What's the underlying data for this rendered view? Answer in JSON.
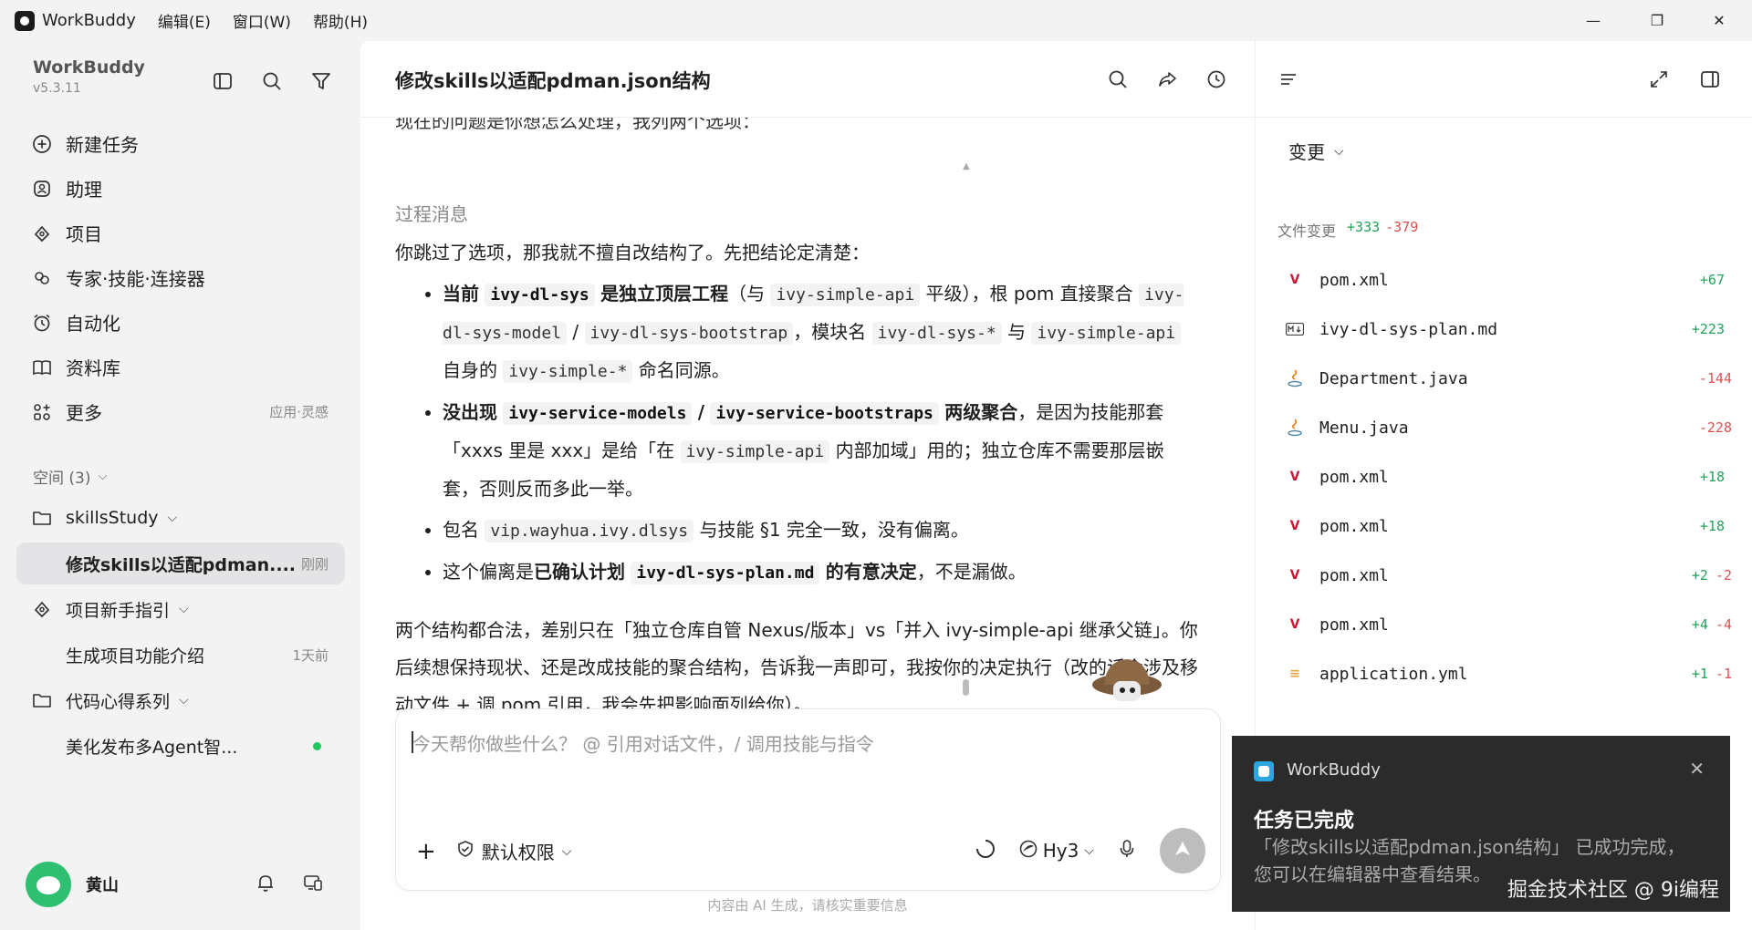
{
  "titlebar": {
    "app_name": "WorkBuddy",
    "menus": [
      "编辑(E)",
      "窗口(W)",
      "帮助(H)"
    ],
    "minimize": "—",
    "restore": "❐",
    "close": "✕"
  },
  "sidebar": {
    "brand_name": "WorkBuddy",
    "version": "v5.3.11",
    "nav": [
      {
        "label": "新建任务"
      },
      {
        "label": "助理"
      },
      {
        "label": "项目"
      },
      {
        "label": "专家·技能·连接器"
      },
      {
        "label": "自动化"
      },
      {
        "label": "资料库"
      },
      {
        "label": "更多",
        "extra": "应用·灵感"
      }
    ],
    "space_head": "空间 (3)",
    "tree": [
      {
        "label": "skillsStudy",
        "type": "folder"
      },
      {
        "label": "修改skills以适配pdman....",
        "time": "刚刚",
        "type": "task"
      },
      {
        "label": "项目新手指引",
        "type": "folder"
      },
      {
        "label": "生成项目功能介绍",
        "time": "1天前",
        "type": "task"
      },
      {
        "label": "代码心得系列",
        "type": "folder"
      },
      {
        "label": "美化发布多Agent智...",
        "type": "task",
        "status_color": "#22c55e"
      }
    ],
    "user_name": "黄山"
  },
  "main": {
    "title": "修改skills以适配pdman.json结构",
    "cut_line": "现在的问题是你想怎么处理，我列两个选项：",
    "process_label": "过程消息",
    "intro": "你跳过了选项，那我就不擅自改结构了。先把结论定清楚：",
    "b1": {
      "bold_a": "当前",
      "code_a": "ivy-dl-sys",
      "bold_b": "是独立顶层工程",
      "t1": "（与",
      "code_b": "ivy-simple-api",
      "t2": "平级），根 pom 直接聚合",
      "code_c": "ivy-dl-sys-model",
      "t3": "/",
      "code_d": "ivy-dl-sys-bootstrap",
      "t4": "，模块名",
      "code_e": "ivy-dl-sys-*",
      "t5": "与",
      "code_f": "ivy-simple-api",
      "t6": "自身的",
      "code_g": "ivy-simple-*",
      "t7": "命名同源。"
    },
    "b2": {
      "bold_a": "没出现",
      "code_a": "ivy-service-models",
      "t1": "/",
      "code_b": "ivy-service-bootstraps",
      "bold_b": "两级聚合",
      "t2": "，是因为技能那套「xxxs 里是 xxx」是给「在",
      "code_c": "ivy-simple-api",
      "t3": "内部加域」用的；独立仓库不需要那层嵌套，否则反而多此一举。"
    },
    "b3": {
      "t1": "包名",
      "code_a": "vip.wayhua.ivy.dlsys",
      "t2": "与技能 §1 完全一致，没有偏离。"
    },
    "b4": {
      "t1": "这个偏离是",
      "bold_a": "已确认计划",
      "code_a": "ivy-dl-sys-plan.md",
      "bold_b": "的有意决定",
      "t2": "，不是漏做。"
    },
    "para2": "两个结构都合法，差别只在「独立仓库自管 Nexus/版本」vs「并入 ivy-simple-api 继承父链」。你后续想保持现状、还是改成技能的聚合结构，告诉我一声即可，我按你的决定执行（改的话会涉及移动文件 + 调 pom 引用，我会先把影响面列给你）。",
    "composer_placeholder": "今天帮你做些什么？ @ 引用对话文件，/ 调用技能与指令",
    "permission_label": "默认权限",
    "model_label": "Hy3",
    "footnote": "内容由 AI 生成，请核实重要信息"
  },
  "rpanel": {
    "tab_label": "变更",
    "summary_label": "文件变更",
    "summary_add": "+333",
    "summary_del": "-379",
    "files": [
      {
        "name": "pom.xml",
        "icon": "maven-icon",
        "add": "+67",
        "del": ""
      },
      {
        "name": "ivy-dl-sys-plan.md",
        "icon": "markdown-icon",
        "add": "+223",
        "del": ""
      },
      {
        "name": "Department.java",
        "icon": "java-icon",
        "add": "",
        "del": "-144"
      },
      {
        "name": "Menu.java",
        "icon": "java-icon",
        "add": "",
        "del": "-228"
      },
      {
        "name": "pom.xml",
        "icon": "maven-icon",
        "add": "+18",
        "del": ""
      },
      {
        "name": "pom.xml",
        "icon": "maven-icon",
        "add": "+18",
        "del": ""
      },
      {
        "name": "pom.xml",
        "icon": "maven-icon",
        "add": "+2",
        "del": "-2"
      },
      {
        "name": "pom.xml",
        "icon": "maven-icon",
        "add": "+4",
        "del": "-4"
      },
      {
        "name": "application.yml",
        "icon": "yaml-icon",
        "add": "+1",
        "del": "-1"
      }
    ]
  },
  "toast": {
    "app": "WorkBuddy",
    "close": "✕",
    "title": "任务已完成",
    "body": "「修改skills以适配pdman.json结构」 已成功完成，您可以在编辑器中查看结果。",
    "watermark": "掘金技术社区 @ 9i编程"
  },
  "colors": {
    "accent_green": "#22a35a",
    "danger_red": "#e05050",
    "toast_bg": "#2b2b2b"
  }
}
